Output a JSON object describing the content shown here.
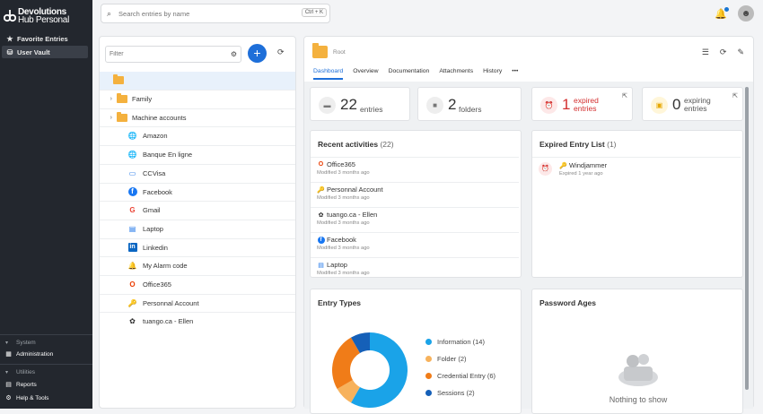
{
  "brand": {
    "line1": "Devolutions",
    "line2": "Hub Personal"
  },
  "sidebar": {
    "items": [
      {
        "label": "Favorite Entries",
        "icon": "star-icon"
      },
      {
        "label": "User Vault",
        "icon": "vault-icon"
      }
    ],
    "system_label": "System",
    "admin_label": "Administration",
    "utilities_label": "Utilities",
    "reports_label": "Reports",
    "help_label": "Help & Tools"
  },
  "topbar": {
    "search_placeholder": "Search entries by name",
    "shortcut": "Ctrl + K"
  },
  "left": {
    "filter_placeholder": "Filter",
    "tree": [
      {
        "label": "Family",
        "type": "folder"
      },
      {
        "label": "Machine accounts",
        "type": "folder"
      },
      {
        "label": "Amazon",
        "type": "web"
      },
      {
        "label": "Banque En ligne",
        "type": "web"
      },
      {
        "label": "CCVisa",
        "type": "card"
      },
      {
        "label": "Facebook",
        "type": "facebook"
      },
      {
        "label": "Gmail",
        "type": "google"
      },
      {
        "label": "Laptop",
        "type": "laptop"
      },
      {
        "label": "Linkedin",
        "type": "linkedin"
      },
      {
        "label": "My Alarm code",
        "type": "alarm"
      },
      {
        "label": "Office365",
        "type": "office"
      },
      {
        "label": "Personnal Account",
        "type": "key"
      },
      {
        "label": "tuango.ca - Ellen",
        "type": "tuango"
      }
    ]
  },
  "main": {
    "root_label": "Root",
    "tabs": [
      "Dashboard",
      "Overview",
      "Documentation",
      "Attachments",
      "History",
      "•••"
    ],
    "stats": [
      {
        "num": "22",
        "unit": "entries"
      },
      {
        "num": "2",
        "unit": "folders"
      },
      {
        "num": "1",
        "unit1": "expired",
        "unit2": "entries"
      },
      {
        "num": "0",
        "unit1": "expiring",
        "unit2": "entries"
      }
    ],
    "recent": {
      "title": "Recent activities",
      "count": "(22)",
      "items": [
        {
          "name": "Office365",
          "meta": "Modified 3 months ago",
          "icon": "office-icon"
        },
        {
          "name": "Personnal Account",
          "meta": "Modified 3 months ago",
          "icon": "key-icon"
        },
        {
          "name": "tuango.ca - Ellen",
          "meta": "Modified 3 months ago",
          "icon": "tuango-icon"
        },
        {
          "name": "Facebook",
          "meta": "Modified 3 months ago",
          "icon": "facebook-icon"
        },
        {
          "name": "Laptop",
          "meta": "Modified 3 months ago",
          "icon": "laptop-icon"
        }
      ]
    },
    "expired": {
      "title": "Expired Entry List",
      "count": "(1)",
      "item": {
        "name": "Windjammer",
        "meta": "Expired 1 year ago"
      }
    },
    "types": {
      "title": "Entry Types"
    },
    "ages": {
      "title": "Password Ages",
      "empty": "Nothing to show"
    }
  },
  "chart_data": {
    "type": "pie",
    "categories": [
      "Information",
      "Folder",
      "Credential Entry",
      "Sessions"
    ],
    "values": [
      14,
      2,
      6,
      2
    ],
    "labels": [
      "Information (14)",
      "Folder (2)",
      "Credential Entry (6)",
      "Sessions (2)"
    ],
    "colors": [
      "#1aa3e8",
      "#f7b25c",
      "#f07c18",
      "#1560b8"
    ]
  },
  "colors": {
    "accent": "#1e6fd9",
    "expired": "#d32f2f"
  }
}
